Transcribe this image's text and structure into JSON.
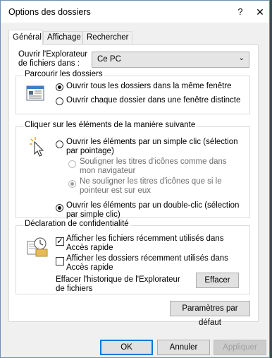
{
  "window": {
    "title": "Options des dossiers",
    "help_glyph": "?",
    "close_glyph": "✕"
  },
  "tabs": [
    {
      "label": "Général",
      "active": true
    },
    {
      "label": "Affichage",
      "active": false
    },
    {
      "label": "Rechercher",
      "active": false
    }
  ],
  "open_explorer": {
    "label": "Ouvrir l'Explorateur de fichiers dans :",
    "value": "Ce PC"
  },
  "browse_folders": {
    "legend": "Parcourir les dossiers",
    "options": [
      {
        "label": "Ouvrir tous les dossiers dans la même fenêtre",
        "selected": true
      },
      {
        "label": "Ouvrir chaque dossier dans une fenêtre distincte",
        "selected": false
      }
    ]
  },
  "click_items": {
    "legend": "Cliquer sur les éléments de la manière suivante",
    "single_click": "Ouvrir les éléments par un simple clic (sélection par pointage)",
    "underline_browser": "Souligner les titres d'icônes comme dans mon navigateur",
    "underline_hover": "Ne souligner les titres d'icônes que si le pointeur est sur eux",
    "double_click": "Ouvrir les éléments par un double-clic (sélection par simple clic)"
  },
  "privacy": {
    "legend": "Déclaration de confidentialité",
    "recent_files": {
      "label": "Afficher les fichiers récemment utilisés dans Accès rapide",
      "checked": true
    },
    "recent_folders": {
      "label": "Afficher les dossiers récemment utilisés dans Accès rapide",
      "checked": false
    },
    "clear_history_label": "Effacer l'historique de l'Explorateur de fichiers",
    "clear_button": "Effacer"
  },
  "defaults_button": "Paramètres par défaut",
  "footer": {
    "ok": "OK",
    "cancel": "Annuler",
    "apply": "Appliquer"
  }
}
